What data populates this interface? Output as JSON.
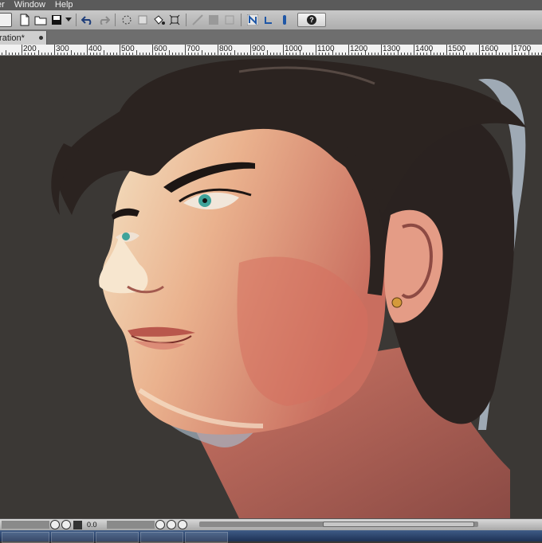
{
  "menu": {
    "items": [
      "er",
      "Window",
      "Help"
    ]
  },
  "tab": {
    "title": "tration*"
  },
  "ruler": {
    "labels": [
      "200",
      "300",
      "400",
      "500",
      "600",
      "700",
      "800",
      "900",
      "1000",
      "1100",
      "1200",
      "1300",
      "1400",
      "1500",
      "1600",
      "1700"
    ]
  },
  "status": {
    "zoom": "0.0"
  },
  "toolbar": {
    "help_label": "?"
  },
  "colors": {
    "canvas_bg": "#3b3835",
    "ui_gray": "#adadad",
    "accent_blue": "#1f57a6"
  }
}
